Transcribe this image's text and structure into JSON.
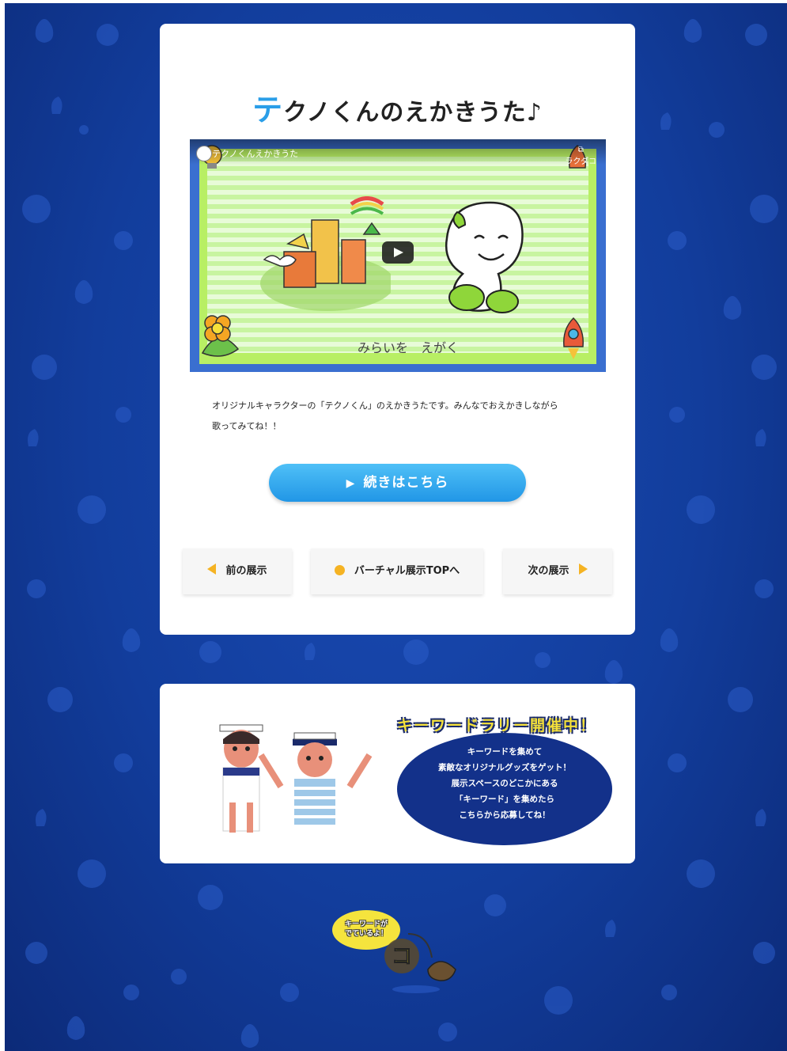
{
  "main": {
    "title_first": "テ",
    "title_rest": "クノくんのえかきうた♪",
    "video": {
      "title": "テクノくんえかきうた",
      "share_label": "ラクダコ",
      "caption": "みらいを　えがく"
    },
    "description_line1": "オリジナルキャラクターの「テクノくん」のえかきうたです。みんなでおえかきしながら",
    "description_line2": "歌ってみてね！！",
    "cta_label": "続きはこちら",
    "nav": {
      "prev_label": "前の展示",
      "top_label": "バーチャル展示TOPへ",
      "next_label": "次の展示"
    }
  },
  "rally": {
    "title": "キーワードラリー開催中！",
    "lines": [
      "キーワードを集めて",
      "素敵なオリジナルグッズをゲット！",
      "展示スペースのどこかにある",
      "「キーワード」を集めたら",
      "こちらから応募してね！"
    ]
  },
  "keyword_bubble": {
    "line1": "キーワードが",
    "line2": "でているよ！",
    "keyword_char": "コ"
  },
  "colors": {
    "background_blue": "#123d9c",
    "accent_blue": "#2196e6",
    "nav_arrow_yellow": "#f5b323",
    "rally_title_yellow": "#f5e13a"
  }
}
